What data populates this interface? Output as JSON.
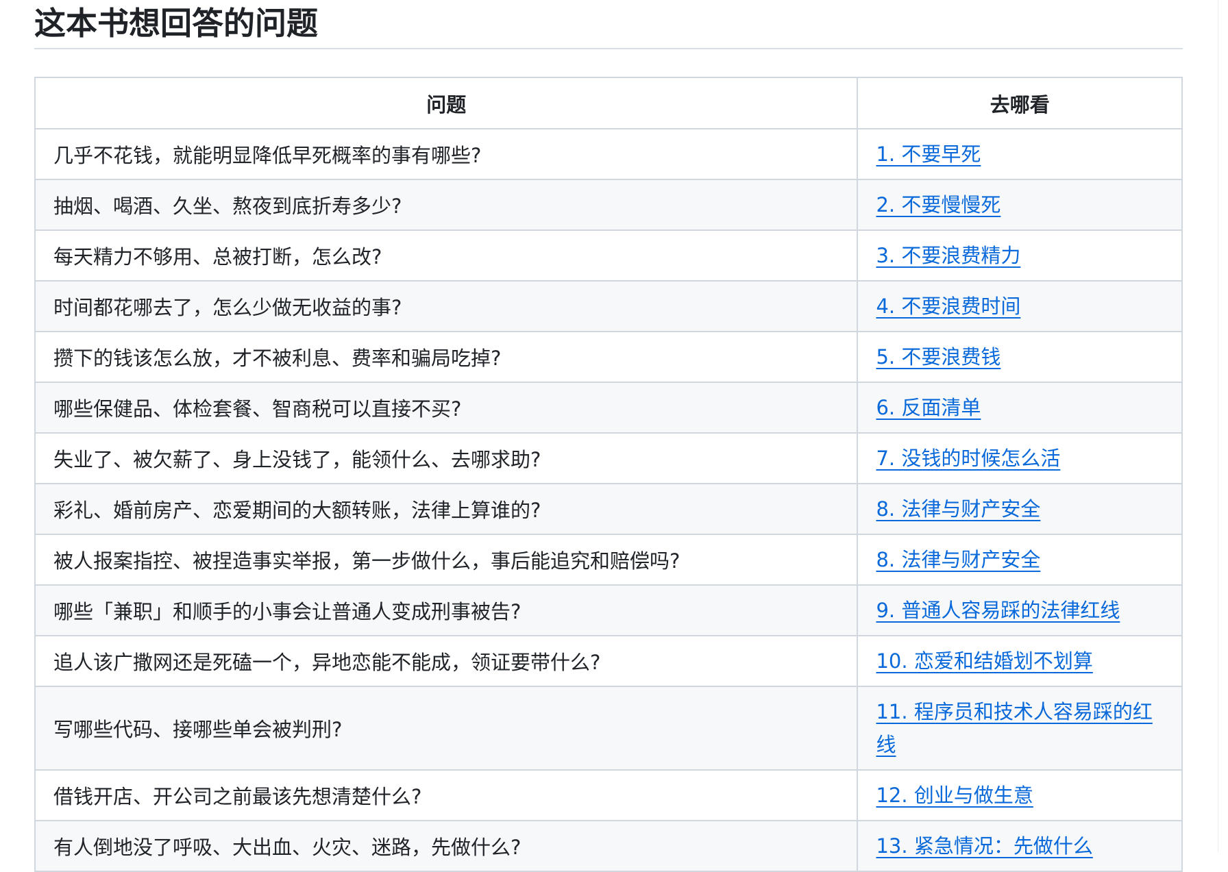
{
  "heading": "这本书想回答的问题",
  "table": {
    "headers": [
      "问题",
      "去哪看"
    ],
    "rows": [
      {
        "question": "几乎不花钱，就能明显降低早死概率的事有哪些?",
        "link": "1. 不要早死"
      },
      {
        "question": "抽烟、喝酒、久坐、熬夜到底折寿多少?",
        "link": "2. 不要慢慢死"
      },
      {
        "question": "每天精力不够用、总被打断，怎么改?",
        "link": "3. 不要浪费精力"
      },
      {
        "question": "时间都花哪去了，怎么少做无收益的事?",
        "link": "4. 不要浪费时间"
      },
      {
        "question": "攒下的钱该怎么放，才不被利息、费率和骗局吃掉?",
        "link": "5. 不要浪费钱"
      },
      {
        "question": "哪些保健品、体检套餐、智商税可以直接不买?",
        "link": "6. 反面清单"
      },
      {
        "question": "失业了、被欠薪了、身上没钱了，能领什么、去哪求助?",
        "link": "7. 没钱的时候怎么活"
      },
      {
        "question": "彩礼、婚前房产、恋爱期间的大额转账，法律上算谁的?",
        "link": "8. 法律与财产安全"
      },
      {
        "question": "被人报案指控、被捏造事实举报，第一步做什么，事后能追究和赔偿吗?",
        "link": "8. 法律与财产安全"
      },
      {
        "question": "哪些「兼职」和顺手的小事会让普通人变成刑事被告?",
        "link": "9. 普通人容易踩的法律红线"
      },
      {
        "question": "追人该广撒网还是死磕一个，异地恋能不能成，领证要带什么?",
        "link": "10. 恋爱和结婚划不划算"
      },
      {
        "question": "写哪些代码、接哪些单会被判刑?",
        "link": "11. 程序员和技术人容易踩的红线"
      },
      {
        "question": "借钱开店、开公司之前最该先想清楚什么?",
        "link": "12. 创业与做生意"
      },
      {
        "question": "有人倒地没了呼吸、大出血、火灾、迷路，先做什么?",
        "link": "13. 紧急情况：先做什么"
      }
    ]
  }
}
